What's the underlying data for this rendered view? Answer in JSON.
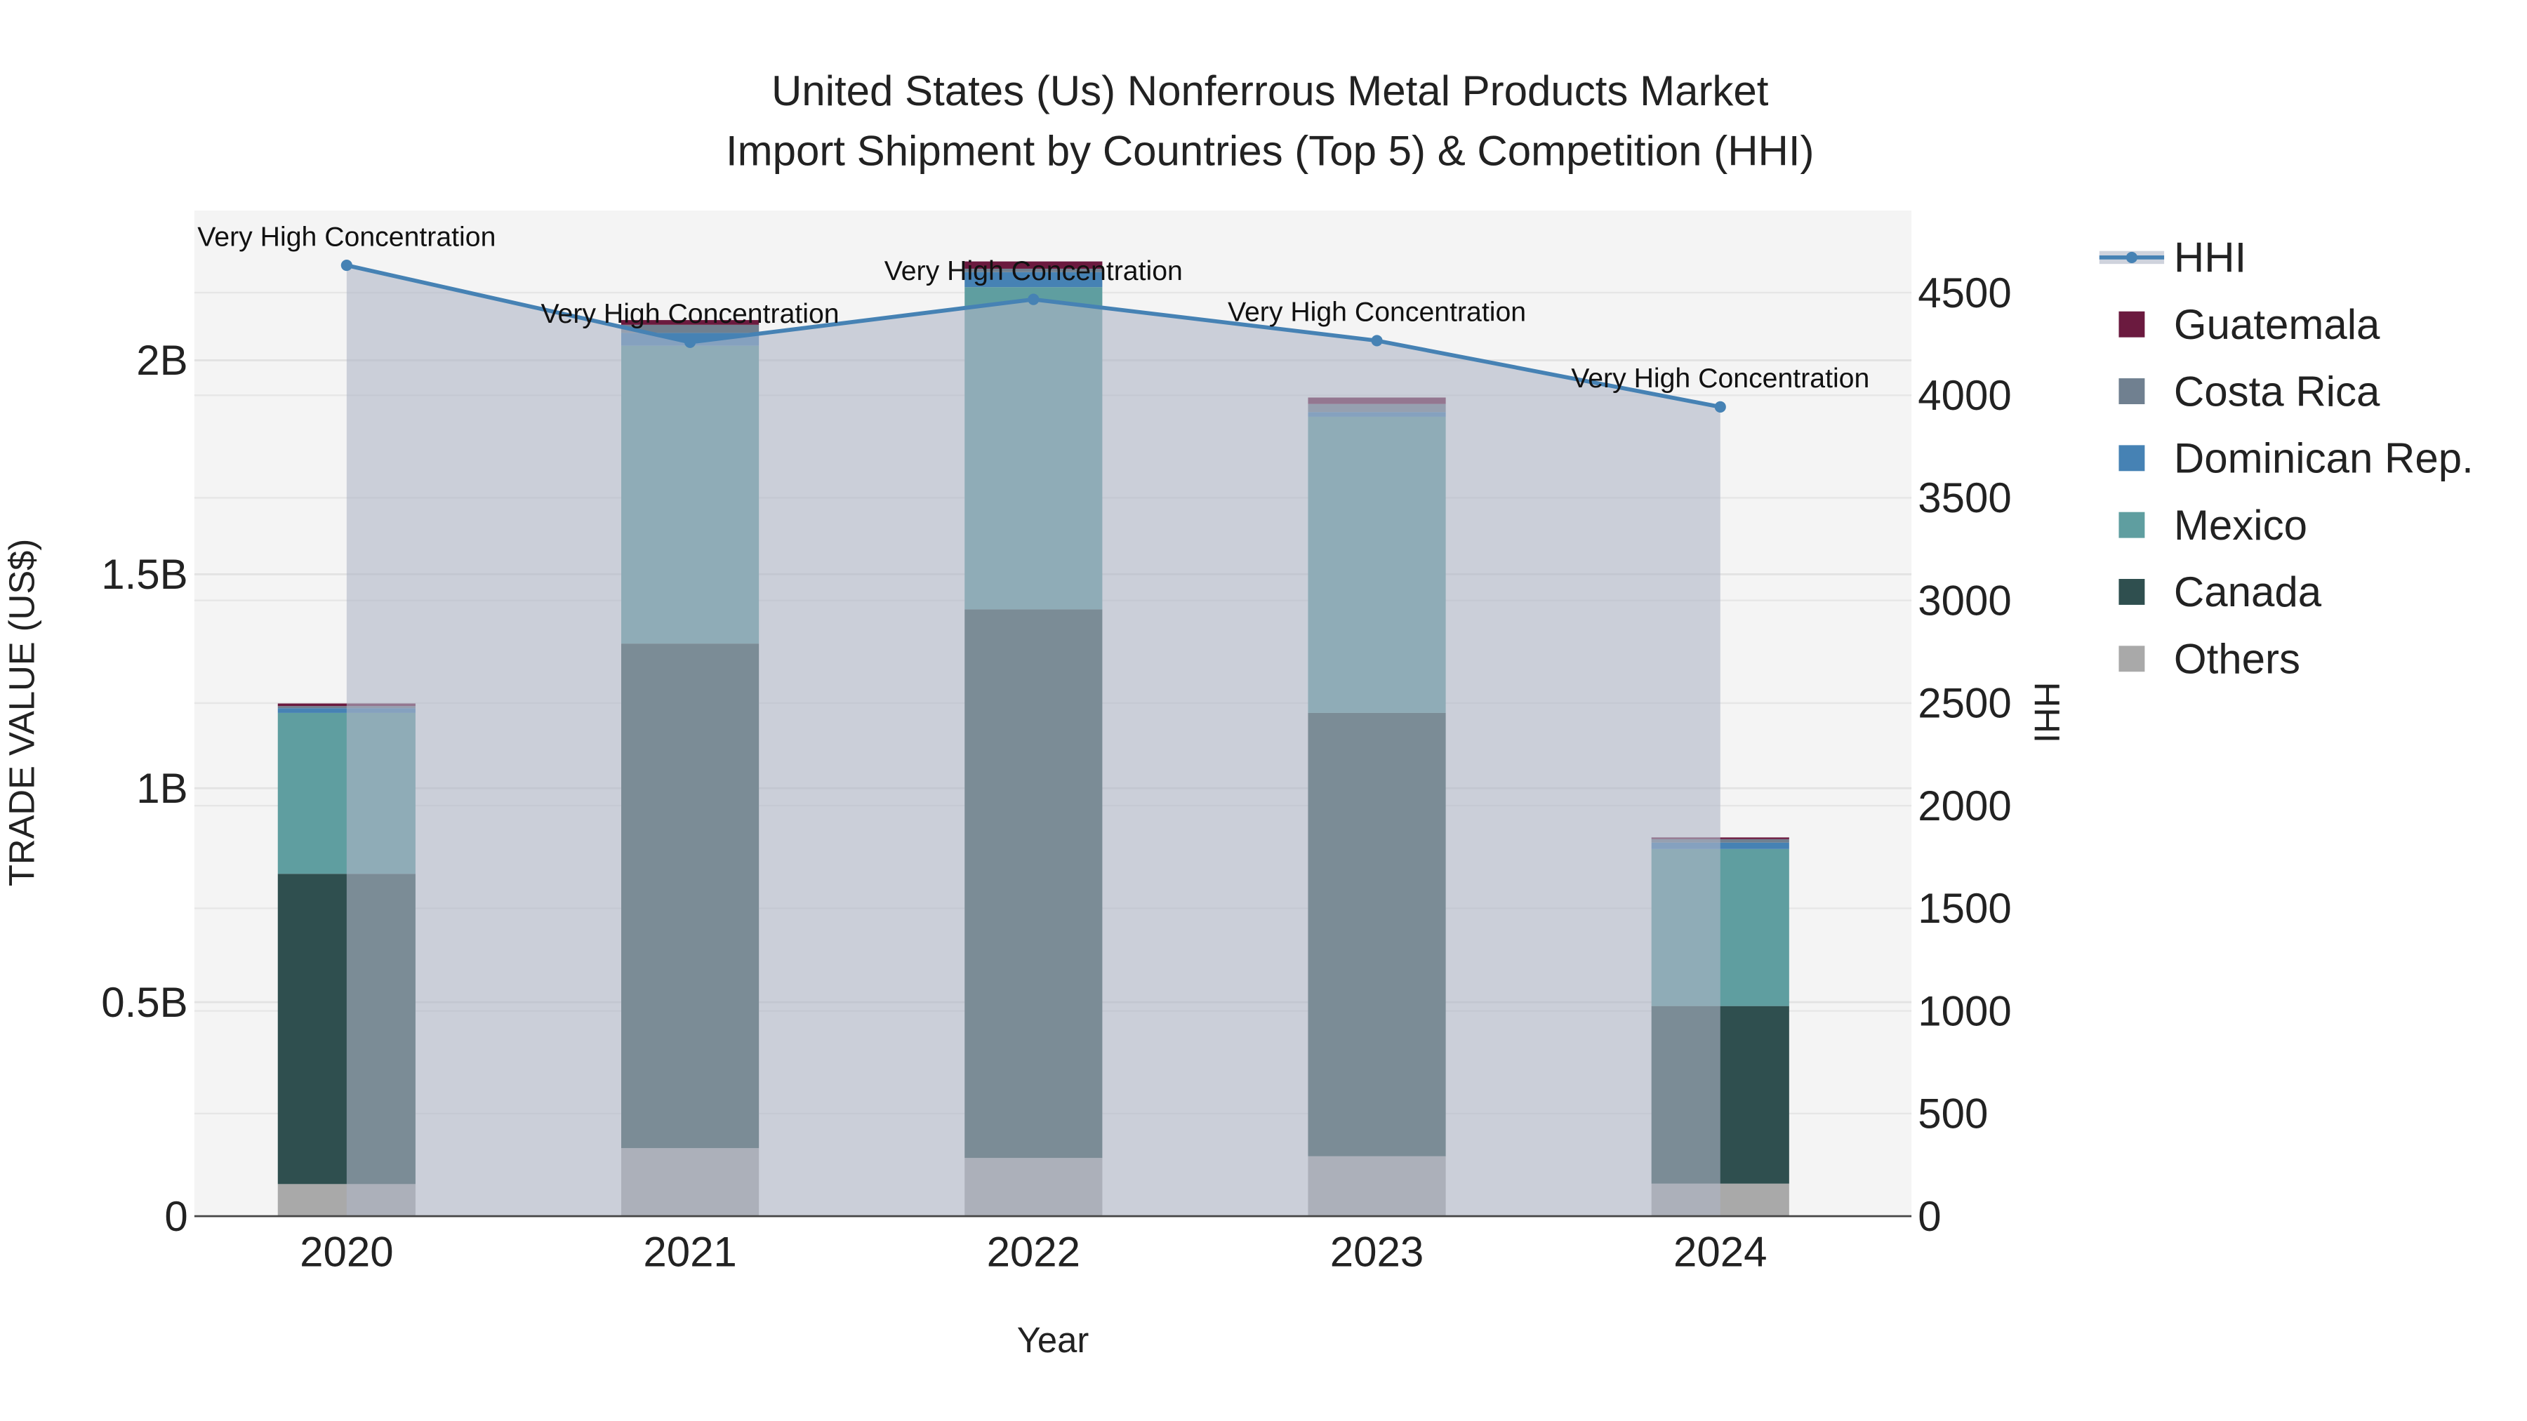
{
  "chart_data": {
    "type": "bar",
    "stacked": true,
    "title": [
      "United States (Us) Nonferrous Metal Products Market",
      "Import Shipment by Countries (Top 5) & Competition (HHI)"
    ],
    "xlabel": "Year",
    "ylabel": "TRADE VALUE (US$)",
    "y2label": "HHI",
    "categories": [
      "2020",
      "2021",
      "2022",
      "2023",
      "2024"
    ],
    "ylim": [
      0,
      2.35
    ],
    "yticks": [
      0,
      0.5,
      1,
      1.5,
      2
    ],
    "ytick_labels": [
      "0",
      "0.5B",
      "1B",
      "1.5B",
      "2B"
    ],
    "y2lim": [
      0,
      4900
    ],
    "y2ticks": [
      0,
      500,
      1000,
      1500,
      2000,
      2500,
      3000,
      3500,
      4000,
      4500
    ],
    "y2tick_labels": [
      "0",
      "500",
      "1000",
      "1500",
      "2000",
      "2500",
      "3000",
      "3500",
      "4000",
      "4500"
    ],
    "units": "billion US$",
    "series": [
      {
        "name": "Others",
        "color": "#A9A9A9",
        "values": [
          0.075,
          0.159,
          0.136,
          0.14,
          0.076
        ]
      },
      {
        "name": "Canada",
        "color": "#2F4F4F",
        "values": [
          0.725,
          1.179,
          1.282,
          1.036,
          0.415
        ]
      },
      {
        "name": "Mexico",
        "color": "#5F9EA0",
        "values": [
          0.376,
          0.696,
          0.753,
          0.692,
          0.367
        ]
      },
      {
        "name": "Dominican Rep.",
        "color": "#4682B4",
        "values": [
          0.011,
          0.03,
          0.035,
          0.011,
          0.015
        ]
      },
      {
        "name": "Costa Rica",
        "color": "#708090",
        "values": [
          0.005,
          0.019,
          0.008,
          0.019,
          0.008
        ]
      },
      {
        "name": "Guatemala",
        "color": "#6B1A3F",
        "values": [
          0.006,
          0.011,
          0.017,
          0.015,
          0.004
        ]
      }
    ],
    "hhi": {
      "name": "HHI",
      "color": "#4682B4",
      "values": [
        4633,
        4258,
        4467,
        4266,
        3943
      ],
      "annotations": [
        "Very High Concentration",
        "Very High Concentration",
        "Very High Concentration",
        "Very High Concentration",
        "Very High Concentration"
      ]
    },
    "legend_order": [
      "HHI",
      "Guatemala",
      "Costa Rica",
      "Dominican Rep.",
      "Mexico",
      "Canada",
      "Others"
    ],
    "legend_position": "right",
    "grid": true
  }
}
